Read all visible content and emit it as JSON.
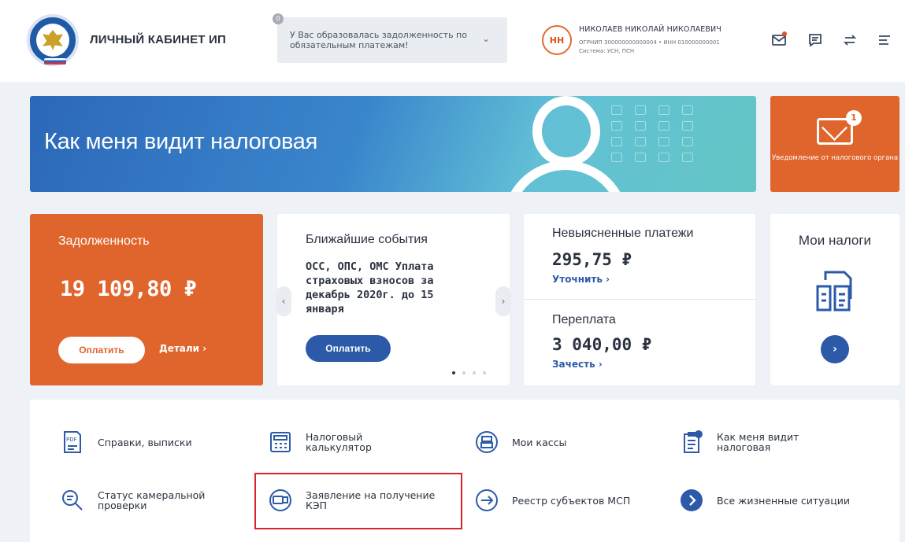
{
  "header": {
    "title": "ЛИЧНЫЙ КАБИНЕТ ИП",
    "alert": {
      "count": "0",
      "text": "У Вас образовалась задолженность по обязательным платежам!"
    },
    "user": {
      "initials": "НН",
      "name": "НИКОЛАЕВ НИКОЛАЙ НИКОЛАЕВИЧ",
      "meta1": "ОГРНИП 300000000000004 • ИНН 010000000001",
      "meta2": "Система: УСН, ПСН"
    }
  },
  "banner": {
    "title": "Как меня видит налоговая",
    "notice_label": "Уведомление от налогового органа",
    "notice_count": "1"
  },
  "cards": {
    "debt": {
      "title": "Задолженность",
      "amount": "19 109,80 ₽",
      "pay_button": "Оплатить",
      "details_link": "Детали ›"
    },
    "events": {
      "title": "Ближайшие события",
      "body": "ОСС, ОПС, ОМС Уплата страховых взносов за декабрь 2020г. до 15 января",
      "pay_button": "Оплатить",
      "prev": "‹",
      "next": "›",
      "active_slide": 1,
      "slide_count": 4
    },
    "payments": {
      "title": "Невыясненные платежи",
      "amount": "295,75 ₽",
      "link": "Уточнить ›",
      "overpay_title": "Переплата",
      "overpay_amount": "3 040,00 ₽",
      "overpay_link": "Зачесть ›"
    },
    "taxes": {
      "title": "Мои налоги",
      "next": "›"
    }
  },
  "services": [
    {
      "label": "Справки, выписки",
      "icon": "pdf-icon"
    },
    {
      "label": "Налоговый\nкалькулятор",
      "icon": "calculator-icon"
    },
    {
      "label": "Мои кассы",
      "icon": "cash-register-icon"
    },
    {
      "label": "Как меня видит\nналоговая",
      "icon": "clipboard-check-icon"
    },
    {
      "label": "Статус камеральной\nпроверки",
      "icon": "magnifier-icon"
    },
    {
      "label": "Заявление на получение\nКЭП",
      "icon": "key-card-icon"
    },
    {
      "label": "Реестр субъектов МСП",
      "icon": "registry-arrow-icon"
    },
    {
      "label": "Все жизненные ситуации",
      "icon": "chevron-right-icon"
    }
  ],
  "colors": {
    "accent_orange": "#e0652d",
    "accent_blue": "#2d5aa8",
    "highlight_red": "#d6262d"
  }
}
